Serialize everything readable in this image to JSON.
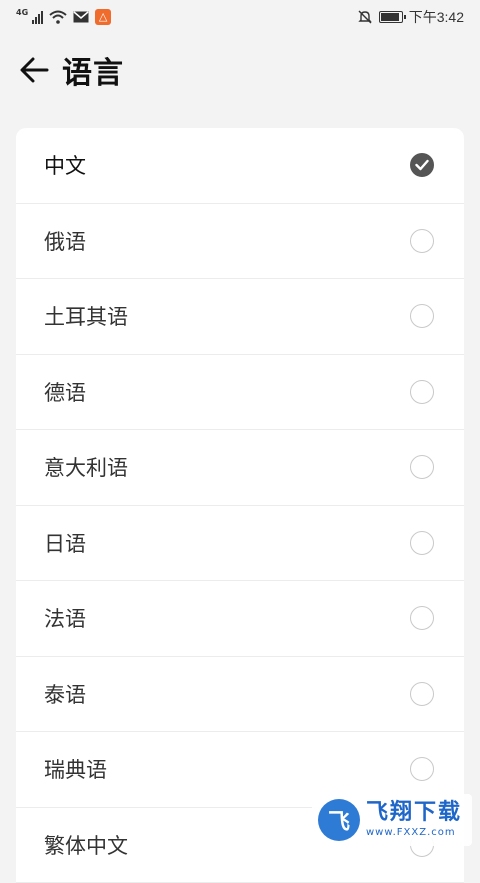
{
  "status_bar": {
    "network_label": "4G",
    "time": "下午3:42",
    "battery_level": 0.9
  },
  "header": {
    "title": "语言"
  },
  "languages": [
    {
      "label": "中文",
      "selected": true
    },
    {
      "label": "俄语",
      "selected": false
    },
    {
      "label": "土耳其语",
      "selected": false
    },
    {
      "label": "德语",
      "selected": false
    },
    {
      "label": "意大利语",
      "selected": false
    },
    {
      "label": "日语",
      "selected": false
    },
    {
      "label": "法语",
      "selected": false
    },
    {
      "label": "泰语",
      "selected": false
    },
    {
      "label": "瑞典语",
      "selected": false
    },
    {
      "label": "繁体中文",
      "selected": false
    }
  ],
  "watermark": {
    "brand": "飞翔下载",
    "url": "www.FXXZ.com"
  },
  "colors": {
    "background": "#f3f3f3",
    "card": "#ffffff",
    "check_fill": "#555555",
    "watermark_blue": "#1f66c9"
  }
}
